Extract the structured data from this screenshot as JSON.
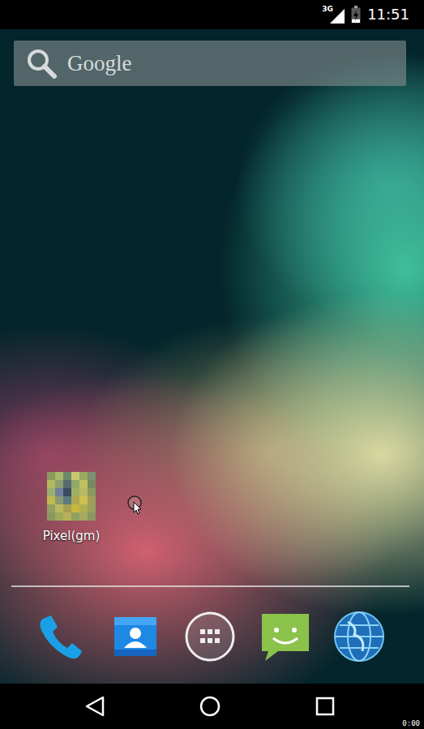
{
  "status_bar": {
    "network": "3G",
    "signal_level": 1.0,
    "battery": {
      "level": 0.25,
      "charging": true
    },
    "time": "11:51"
  },
  "search": {
    "label": "Google"
  },
  "apps": [
    {
      "label": "Pixel(gm)"
    }
  ],
  "dock": [
    {
      "kind": "phone"
    },
    {
      "kind": "contacts"
    },
    {
      "kind": "launcher"
    },
    {
      "kind": "messaging"
    },
    {
      "kind": "browser"
    }
  ],
  "nav": [
    {
      "kind": "back"
    },
    {
      "kind": "home"
    },
    {
      "kind": "recents"
    }
  ],
  "recording": {
    "timer": "0:00"
  }
}
